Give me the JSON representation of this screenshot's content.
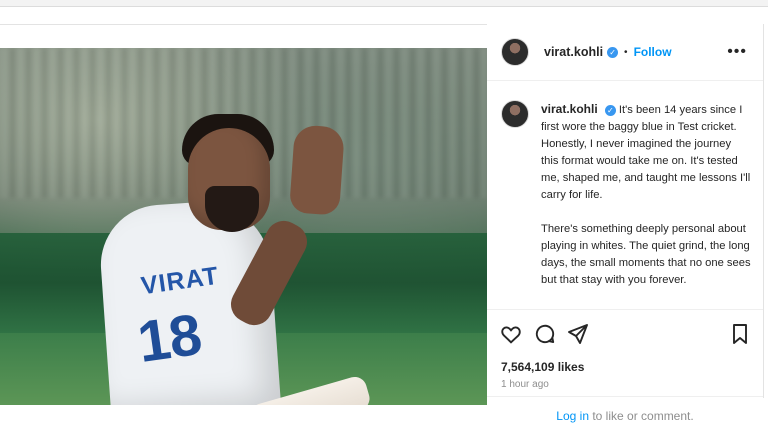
{
  "post": {
    "username": "virat.kohli",
    "verified_icon": "✓",
    "separator": "•",
    "follow_label": "Follow",
    "more_label": "•••",
    "caption_paragraph_1": "It's been 14 years since I first wore the baggy blue in Test cricket. Honestly, I never imagined the journey this format would take me on. It's tested me, shaped me, and taught me lessons I'll carry for life.",
    "caption_paragraph_2": "There's something deeply personal about playing in whites. The quiet grind, the long days, the small moments that no one sees but that stay with you forever.",
    "likes": "7,564,109 likes",
    "time": "1 hour ago",
    "login_link": "Log in",
    "login_suffix": " to like or comment.",
    "shirt_name": "VIRAT",
    "shirt_number": "18"
  },
  "icons": {
    "like": "heart-icon",
    "comment": "comment-icon",
    "share": "share-icon",
    "save": "bookmark-icon"
  },
  "colors": {
    "accent": "#0095f6",
    "verified": "#3897f0",
    "muted": "#8e8e8e"
  }
}
